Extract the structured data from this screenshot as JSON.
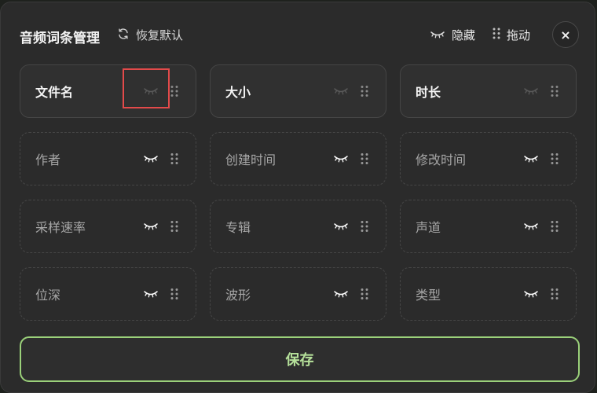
{
  "header": {
    "title": "音频词条管理",
    "reset_label": "恢复默认",
    "legend_hide_label": "隐藏",
    "legend_drag_label": "拖动",
    "close_label": "×"
  },
  "fields": [
    {
      "label": "文件名",
      "visible": true
    },
    {
      "label": "大小",
      "visible": true
    },
    {
      "label": "时长",
      "visible": true
    },
    {
      "label": "作者",
      "visible": false
    },
    {
      "label": "创建时间",
      "visible": false
    },
    {
      "label": "修改时间",
      "visible": false
    },
    {
      "label": "采样速率",
      "visible": false
    },
    {
      "label": "专辑",
      "visible": false
    },
    {
      "label": "声道",
      "visible": false
    },
    {
      "label": "位深",
      "visible": false
    },
    {
      "label": "波形",
      "visible": false
    },
    {
      "label": "类型",
      "visible": false
    }
  ],
  "footer": {
    "save_label": "保存"
  },
  "colors": {
    "accent": "#9bd17a",
    "highlight": "#e34a4a",
    "eye_hidden": "#ffffff",
    "eye_visible": "#5a5a5a"
  },
  "icons": {
    "reset": "refresh-icon",
    "hide": "closed-eye-icon",
    "drag": "drag-handle-icon",
    "close": "close-icon"
  }
}
